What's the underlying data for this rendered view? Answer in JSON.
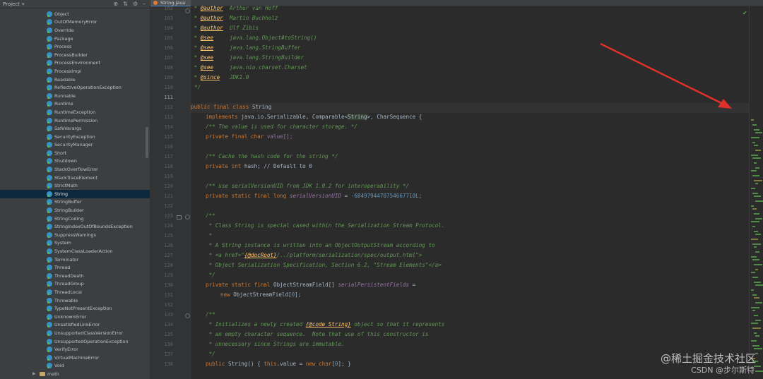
{
  "project_panel": {
    "title": "Project",
    "classes": [
      "Object",
      "OutOfMemoryError",
      "Override",
      "Package",
      "Process",
      "ProcessBuilder",
      "ProcessEnvironment",
      "ProcessImpl",
      "Readable",
      "ReflectiveOperationException",
      "Runnable",
      "Runtime",
      "RuntimeException",
      "RuntimePermission",
      "SafeVarargs",
      "SecurityException",
      "SecurityManager",
      "Short",
      "Shutdown",
      "StackOverflowError",
      "StackTraceElement",
      "StrictMath",
      "String",
      "StringBuffer",
      "StringBuilder",
      "StringCoding",
      "StringIndexOutOfBoundsException",
      "SuppressWarnings",
      "System",
      "SystemClassLoaderAction",
      "Terminator",
      "Thread",
      "ThreadDeath",
      "ThreadGroup",
      "ThreadLocal",
      "Throwable",
      "TypeNotPresentException",
      "UnknownError",
      "UnsatisfiedLinkError",
      "UnsupportedClassVersionError",
      "UnsupportedOperationException",
      "VerifyError",
      "VirtualMachineError",
      "Void"
    ],
    "selected": "String",
    "next_package": "math"
  },
  "editor": {
    "tab_label": "String.java",
    "line_numbers": [
      "182",
      "183",
      "184",
      "185",
      "186",
      "187",
      "188",
      "189",
      "110",
      "111",
      "112",
      "113",
      "114",
      "115",
      "116",
      "117",
      "118",
      "119",
      "120",
      "121",
      "122",
      "123",
      "124",
      "125",
      "126",
      "127",
      "128",
      "129",
      "130",
      "131",
      "132",
      "133",
      "134",
      "135",
      "136",
      "137",
      "138"
    ],
    "current_line": "111"
  },
  "code": {
    "l182": [
      "* ",
      "@author",
      "  Arthur van Hoff"
    ],
    "l183": [
      "* ",
      "@author",
      "  Martin Buchholz"
    ],
    "l184": [
      "* ",
      "@author",
      "  Ulf Zibis"
    ],
    "l185": [
      "* ",
      "@see",
      "     java.lang.Object",
      "#toString()"
    ],
    "l186": [
      "* ",
      "@see",
      "     java.lang.StringBuffer"
    ],
    "l187": [
      "* ",
      "@see",
      "     java.lang.StringBuilder"
    ],
    "l188": [
      "* ",
      "@see",
      "     java.nio.charset.Charset"
    ],
    "l189": [
      "* ",
      "@since",
      "   JDK1.0"
    ],
    "l190": "*/",
    "l111_kw": "public final class ",
    "l111_name": "String",
    "l112_kw": "implements ",
    "l112_a": "java.io.Serializable, Comparable<",
    "l112_hl": "String",
    "l112_b": ">, CharSequence {",
    "l113": "/** The value is used for character storage. */",
    "l114_kw": "private final char ",
    "l114_rest": "value[];",
    "l116": "/** Cache the hash code for the string */",
    "l117_kw": "private int ",
    "l117_rest": "hash; // Default to 0",
    "l119": "/** use serialVersionUID from JDK 1.0.2 for interoperability */",
    "l120_kw": "private static final long ",
    "l120_fn": "serialVersionUID",
    "l120_eq": " = ",
    "l120_num": "-6849794470754667710L",
    "l120_end": ";",
    "l122": "/**",
    "l123": " * Class String is special cased within the Serialization Stream Protocol.",
    "l124": " *",
    "l125": " * A String instance is written into an ObjectOutputStream according to",
    "l126_a": " * <a href=\"",
    "l126_b": "{@docRoot}",
    "l126_c": "/../platform/serialization/spec/output.html\">",
    "l127": " * Object Serialization Specification, Section 6.2, \"Stream Elements\"</a>",
    "l128": " */",
    "l129_kw": "private static final ",
    "l129_a": "ObjectStreamField[] ",
    "l129_fn": "serialPersistentFields",
    "l129_b": " =",
    "l130_kw": "new ",
    "l130_a": "ObjectStreamField[",
    "l130_num": "0",
    "l130_b": "];",
    "l132": "/**",
    "l133_a": " * Initializes a newly created ",
    "l133_b": "{@code String}",
    "l133_c": " object so that it represents",
    "l134": " * an empty character sequence.  Note that use of this constructor is",
    "l135": " * unnecessary since Strings are immutable.",
    "l136": " */",
    "l137_kw": "public ",
    "l137_a": "String() { ",
    "l137_kw2": "this",
    "l137_b": ".value = ",
    "l137_kw3": "new char",
    "l137_c": "[",
    "l137_num": "0",
    "l137_d": "]; }"
  },
  "watermark": {
    "line1": "@稀土掘金技术社区",
    "line2": "CSDN @步尔斯特"
  },
  "colors": {
    "arrow": "#e0302a",
    "accent": "#4a88c7"
  }
}
